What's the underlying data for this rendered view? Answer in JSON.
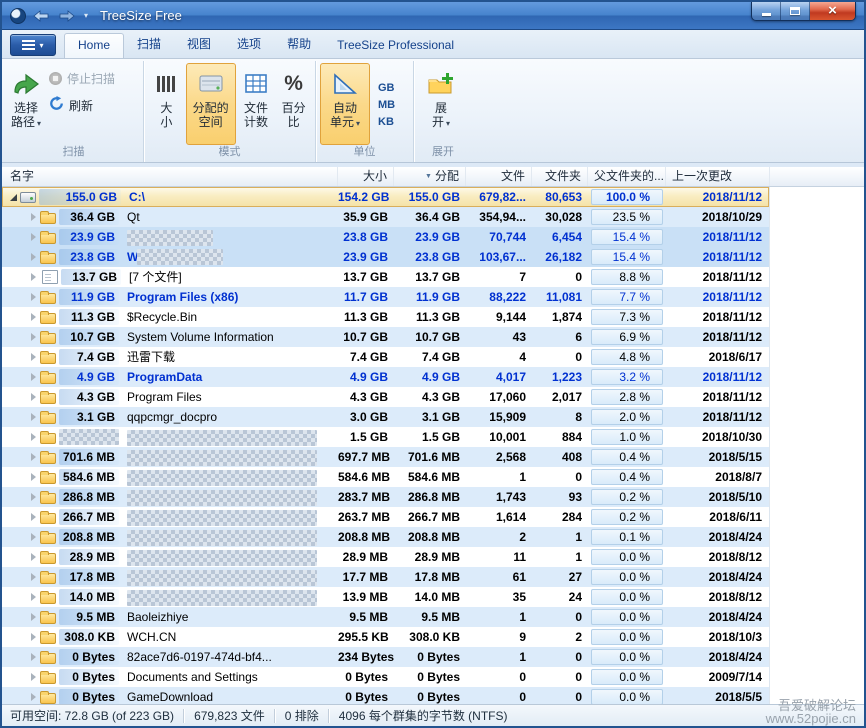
{
  "window": {
    "title": "TreeSize Free"
  },
  "icons": {
    "app_logo": "treesize-pie-logo",
    "back": "arrow-left",
    "forward": "arrow-right",
    "app_menu": "list-lines",
    "sort": "triangle-down"
  },
  "ribbon": {
    "tabs": [
      {
        "label": "Home",
        "active": true
      },
      {
        "label": "扫描"
      },
      {
        "label": "视图"
      },
      {
        "label": "选项"
      },
      {
        "label": "帮助"
      },
      {
        "label": "TreeSize Professional"
      }
    ],
    "scan": {
      "label": "扫描",
      "select_l1": "选择",
      "select_l2": "路径",
      "stop": "停止扫描",
      "refresh": "刷新"
    },
    "mode": {
      "label": "模式",
      "size_l1": "大",
      "size_l2": "小",
      "alloc_l1": "分配的",
      "alloc_l2": "空间",
      "count_l1": "文件",
      "count_l2": "计数",
      "pct_l1": "百分",
      "pct_l2": "比"
    },
    "unit": {
      "label": "单位",
      "auto_l1": "自动",
      "auto_l2": "单元",
      "gb": "GB",
      "mb": "MB",
      "kb": "KB"
    },
    "expand": {
      "label": "展开",
      "exp_l1": "展",
      "exp_l2": "开"
    }
  },
  "table": {
    "columns": [
      "名字",
      "大小",
      "分配",
      "文件",
      "文件夹",
      "父文件夹的...",
      "上一次更改"
    ],
    "rows": [
      {
        "level": 0,
        "expanded": true,
        "selected": true,
        "icon": "drive",
        "bg": "selected",
        "text": "blue",
        "size_label": "155.0 GB",
        "name": "C:\\",
        "censored": false,
        "size": "154.2 GB",
        "alloc": "155.0 GB",
        "files": "679,82...",
        "folders": "80,653",
        "pct": "100.0 %",
        "date": "2018/11/12"
      },
      {
        "level": 1,
        "expanded": false,
        "selected": false,
        "icon": "folder",
        "bg": "blue",
        "text": "black",
        "size_label": "36.4 GB",
        "name": "Qt",
        "censored": false,
        "size": "35.9 GB",
        "alloc": "36.4 GB",
        "files": "354,94...",
        "folders": "30,028",
        "pct": "23.5 %",
        "date": "2018/10/29"
      },
      {
        "level": 1,
        "expanded": false,
        "selected": false,
        "icon": "folder",
        "bg": "blue2",
        "text": "blue",
        "size_label": "23.9 GB",
        "name": null,
        "censor_w": 86,
        "censored": true,
        "size": "23.8 GB",
        "alloc": "23.9 GB",
        "files": "70,744",
        "folders": "6,454",
        "pct": "15.4 %",
        "date": "2018/11/12"
      },
      {
        "level": 1,
        "expanded": false,
        "selected": false,
        "icon": "folder",
        "bg": "blue2",
        "text": "blue",
        "size_label": "23.8 GB",
        "name": "Windows",
        "censored": true,
        "size": "23.9 GB",
        "alloc": "23.8 GB",
        "files": "103,67...",
        "folders": "26,182",
        "pct": "15.4 %",
        "date": "2018/11/12"
      },
      {
        "level": 1,
        "expanded": false,
        "selected": false,
        "icon": "file",
        "bg": "white",
        "text": "black",
        "size_label": "13.7 GB",
        "name": "[7 个文件]",
        "censored": false,
        "size": "13.7 GB",
        "alloc": "13.7 GB",
        "files": "7",
        "folders": "0",
        "pct": "8.8 %",
        "date": "2018/11/12"
      },
      {
        "level": 1,
        "expanded": false,
        "selected": false,
        "icon": "folder",
        "bg": "blue",
        "text": "blue",
        "size_label": "11.9 GB",
        "name": "Program Files (x86)",
        "censored": false,
        "size": "11.7 GB",
        "alloc": "11.9 GB",
        "files": "88,222",
        "folders": "11,081",
        "pct": "7.7 %",
        "date": "2018/11/12"
      },
      {
        "level": 1,
        "expanded": false,
        "selected": false,
        "icon": "folder",
        "bg": "white",
        "text": "black",
        "size_label": "11.3 GB",
        "name": "$Recycle.Bin",
        "censored": false,
        "size": "11.3 GB",
        "alloc": "11.3 GB",
        "files": "9,144",
        "folders": "1,874",
        "pct": "7.3 %",
        "date": "2018/11/12"
      },
      {
        "level": 1,
        "expanded": false,
        "selected": false,
        "icon": "folder",
        "bg": "blue",
        "text": "black",
        "size_label": "10.7 GB",
        "name": "System Volume Information",
        "censored": false,
        "size": "10.7 GB",
        "alloc": "10.7 GB",
        "files": "43",
        "folders": "6",
        "pct": "6.9 %",
        "date": "2018/11/12"
      },
      {
        "level": 1,
        "expanded": false,
        "selected": false,
        "icon": "folder",
        "bg": "white",
        "text": "black",
        "size_label": "7.4 GB",
        "name": "迅雷下载",
        "censored": false,
        "size": "7.4 GB",
        "alloc": "7.4 GB",
        "files": "4",
        "folders": "0",
        "pct": "4.8 %",
        "date": "2018/6/17"
      },
      {
        "level": 1,
        "expanded": false,
        "selected": false,
        "icon": "folder",
        "bg": "blue",
        "text": "blue",
        "size_label": "4.9 GB",
        "name": "ProgramData",
        "censored": false,
        "size": "4.9 GB",
        "alloc": "4.9 GB",
        "files": "4,017",
        "folders": "1,223",
        "pct": "3.2 %",
        "date": "2018/11/12"
      },
      {
        "level": 1,
        "expanded": false,
        "selected": false,
        "icon": "folder",
        "bg": "white",
        "text": "black",
        "size_label": "4.3 GB",
        "name": "Program Files",
        "censored": false,
        "size": "4.3 GB",
        "alloc": "4.3 GB",
        "files": "17,060",
        "folders": "2,017",
        "pct": "2.8 %",
        "date": "2018/11/12"
      },
      {
        "level": 1,
        "expanded": false,
        "selected": false,
        "icon": "folder",
        "bg": "blue",
        "text": "black",
        "size_label": "3.1 GB",
        "name": "qqpcmgr_docpro",
        "censored": false,
        "size": "3.0 GB",
        "alloc": "3.1 GB",
        "files": "15,909",
        "folders": "8",
        "pct": "2.0 %",
        "date": "2018/11/12"
      },
      {
        "level": 1,
        "expanded": false,
        "selected": false,
        "icon": "folder",
        "bg": "white",
        "text": "black",
        "size_label": null,
        "size_censored": true,
        "name": null,
        "censor_w": 190,
        "censored": true,
        "size": "1.5 GB",
        "alloc": "1.5 GB",
        "files": "10,001",
        "folders": "884",
        "pct": "1.0 %",
        "date": "2018/10/30"
      },
      {
        "level": 1,
        "expanded": false,
        "selected": false,
        "icon": "folder",
        "bg": "blue",
        "text": "black",
        "size_label": "701.6 MB",
        "name": null,
        "censor_w": 190,
        "censored": true,
        "size": "697.7 MB",
        "alloc": "701.6 MB",
        "files": "2,568",
        "folders": "408",
        "pct": "0.4 %",
        "date": "2018/5/15"
      },
      {
        "level": 1,
        "expanded": false,
        "selected": false,
        "icon": "folder",
        "bg": "white",
        "text": "black",
        "size_label": "584.6 MB",
        "name": null,
        "censor_w": 190,
        "censored": true,
        "size": "584.6 MB",
        "alloc": "584.6 MB",
        "files": "1",
        "folders": "0",
        "pct": "0.4 %",
        "date": "2018/8/7"
      },
      {
        "level": 1,
        "expanded": false,
        "selected": false,
        "icon": "folder",
        "bg": "blue",
        "text": "black",
        "size_label": "286.8 MB",
        "name": null,
        "censor_w": 190,
        "censored": true,
        "size": "283.7 MB",
        "alloc": "286.8 MB",
        "files": "1,743",
        "folders": "93",
        "pct": "0.2 %",
        "date": "2018/5/10"
      },
      {
        "level": 1,
        "expanded": false,
        "selected": false,
        "icon": "folder",
        "bg": "white",
        "text": "black",
        "size_label": "266.7 MB",
        "name": null,
        "censor_w": 190,
        "censored": true,
        "size": "263.7 MB",
        "alloc": "266.7 MB",
        "files": "1,614",
        "folders": "284",
        "pct": "0.2 %",
        "date": "2018/6/11"
      },
      {
        "level": 1,
        "expanded": false,
        "selected": false,
        "icon": "folder",
        "bg": "blue",
        "text": "black",
        "size_label": "208.8 MB",
        "name": null,
        "censor_w": 190,
        "censored": true,
        "size": "208.8 MB",
        "alloc": "208.8 MB",
        "files": "2",
        "folders": "1",
        "pct": "0.1 %",
        "date": "2018/4/24"
      },
      {
        "level": 1,
        "expanded": false,
        "selected": false,
        "icon": "folder",
        "bg": "white",
        "text": "black",
        "size_label": "28.9 MB",
        "name": null,
        "censor_w": 190,
        "censored": true,
        "size": "28.9 MB",
        "alloc": "28.9 MB",
        "files": "11",
        "folders": "1",
        "pct": "0.0 %",
        "date": "2018/8/12"
      },
      {
        "level": 1,
        "expanded": false,
        "selected": false,
        "icon": "folder",
        "bg": "blue",
        "text": "black",
        "size_label": "17.8 MB",
        "name": null,
        "censor_w": 190,
        "censored": true,
        "size": "17.7 MB",
        "alloc": "17.8 MB",
        "files": "61",
        "folders": "27",
        "pct": "0.0 %",
        "date": "2018/4/24"
      },
      {
        "level": 1,
        "expanded": false,
        "selected": false,
        "icon": "folder",
        "bg": "white",
        "text": "black",
        "size_label": "14.0 MB",
        "name": null,
        "censor_w": 190,
        "censored": true,
        "size": "13.9 MB",
        "alloc": "14.0 MB",
        "files": "35",
        "folders": "24",
        "pct": "0.0 %",
        "date": "2018/8/12"
      },
      {
        "level": 1,
        "expanded": false,
        "selected": false,
        "icon": "folder",
        "bg": "blue",
        "text": "black",
        "size_label": "9.5 MB",
        "name": "Baoleizhiye",
        "censored": false,
        "size": "9.5 MB",
        "alloc": "9.5 MB",
        "files": "1",
        "folders": "0",
        "pct": "0.0 %",
        "date": "2018/4/24"
      },
      {
        "level": 1,
        "expanded": false,
        "selected": false,
        "icon": "folder",
        "bg": "white",
        "text": "black",
        "size_label": "308.0 KB",
        "name": "WCH.CN",
        "censored": false,
        "size": "295.5 KB",
        "alloc": "308.0 KB",
        "files": "9",
        "folders": "2",
        "pct": "0.0 %",
        "date": "2018/10/3"
      },
      {
        "level": 1,
        "expanded": false,
        "selected": false,
        "icon": "folder",
        "bg": "blue",
        "text": "black",
        "size_label": "0 Bytes",
        "name": "82ace7d6-0197-474d-bf4...",
        "censored": false,
        "size": "234 Bytes",
        "alloc": "0 Bytes",
        "files": "1",
        "folders": "0",
        "pct": "0.0 %",
        "date": "2018/4/24"
      },
      {
        "level": 1,
        "expanded": false,
        "selected": false,
        "icon": "folder",
        "bg": "white",
        "text": "black",
        "size_label": "0 Bytes",
        "name": "Documents and Settings",
        "censored": false,
        "size": "0 Bytes",
        "alloc": "0 Bytes",
        "files": "0",
        "folders": "0",
        "pct": "0.0 %",
        "date": "2009/7/14"
      },
      {
        "level": 1,
        "expanded": false,
        "selected": false,
        "icon": "folder",
        "bg": "blue",
        "text": "black",
        "size_label": "0 Bytes",
        "name": "GameDownload",
        "censored": false,
        "size": "0 Bytes",
        "alloc": "0 Bytes",
        "files": "0",
        "folders": "0",
        "pct": "0.0 %",
        "date": "2018/5/5"
      }
    ]
  },
  "statusbar": {
    "free_space": "可用空间: 72.8 GB  (of 223 GB)",
    "files": "679,823  文件",
    "excluded": "0 排除",
    "cluster": "4096  每个群集的字节数 (NTFS)"
  },
  "watermark": {
    "line1": "吾爱破解论坛",
    "line2": "www.52pojie.cn"
  }
}
